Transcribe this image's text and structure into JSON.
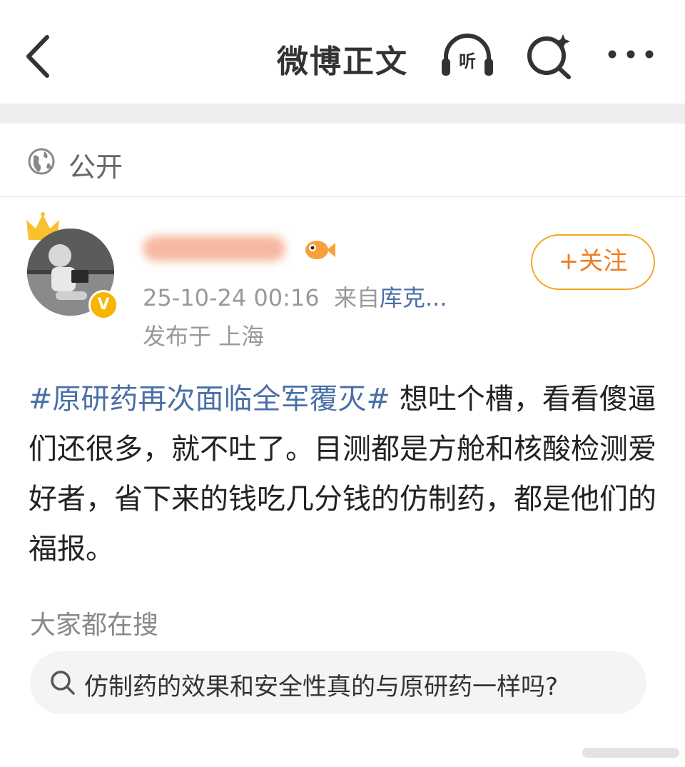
{
  "header": {
    "title": "微博正文",
    "listen_label": "听"
  },
  "visibility": {
    "label": "公开"
  },
  "post": {
    "author_badge": "V",
    "timestamp": "25-10-24 00:16",
    "source_prefix": "来自",
    "source": "库克...",
    "location": "发布于 上海",
    "follow_label": "+关注",
    "hashtag": "#原研药再次面临全军覆灭#",
    "body": " 想吐个槽，看看傻逼们还很多，就不吐了。目测都是方舱和核酸检测爱好者，省下来的钱吃几分钱的仿制药，都是他们的福报。"
  },
  "search": {
    "label": "大家都在搜",
    "suggestion": "仿制药的效果和安全性真的与原研药一样吗?"
  },
  "colors": {
    "link": "#4a6fa5",
    "follow": "#f07d21",
    "badge": "#f7b500"
  }
}
